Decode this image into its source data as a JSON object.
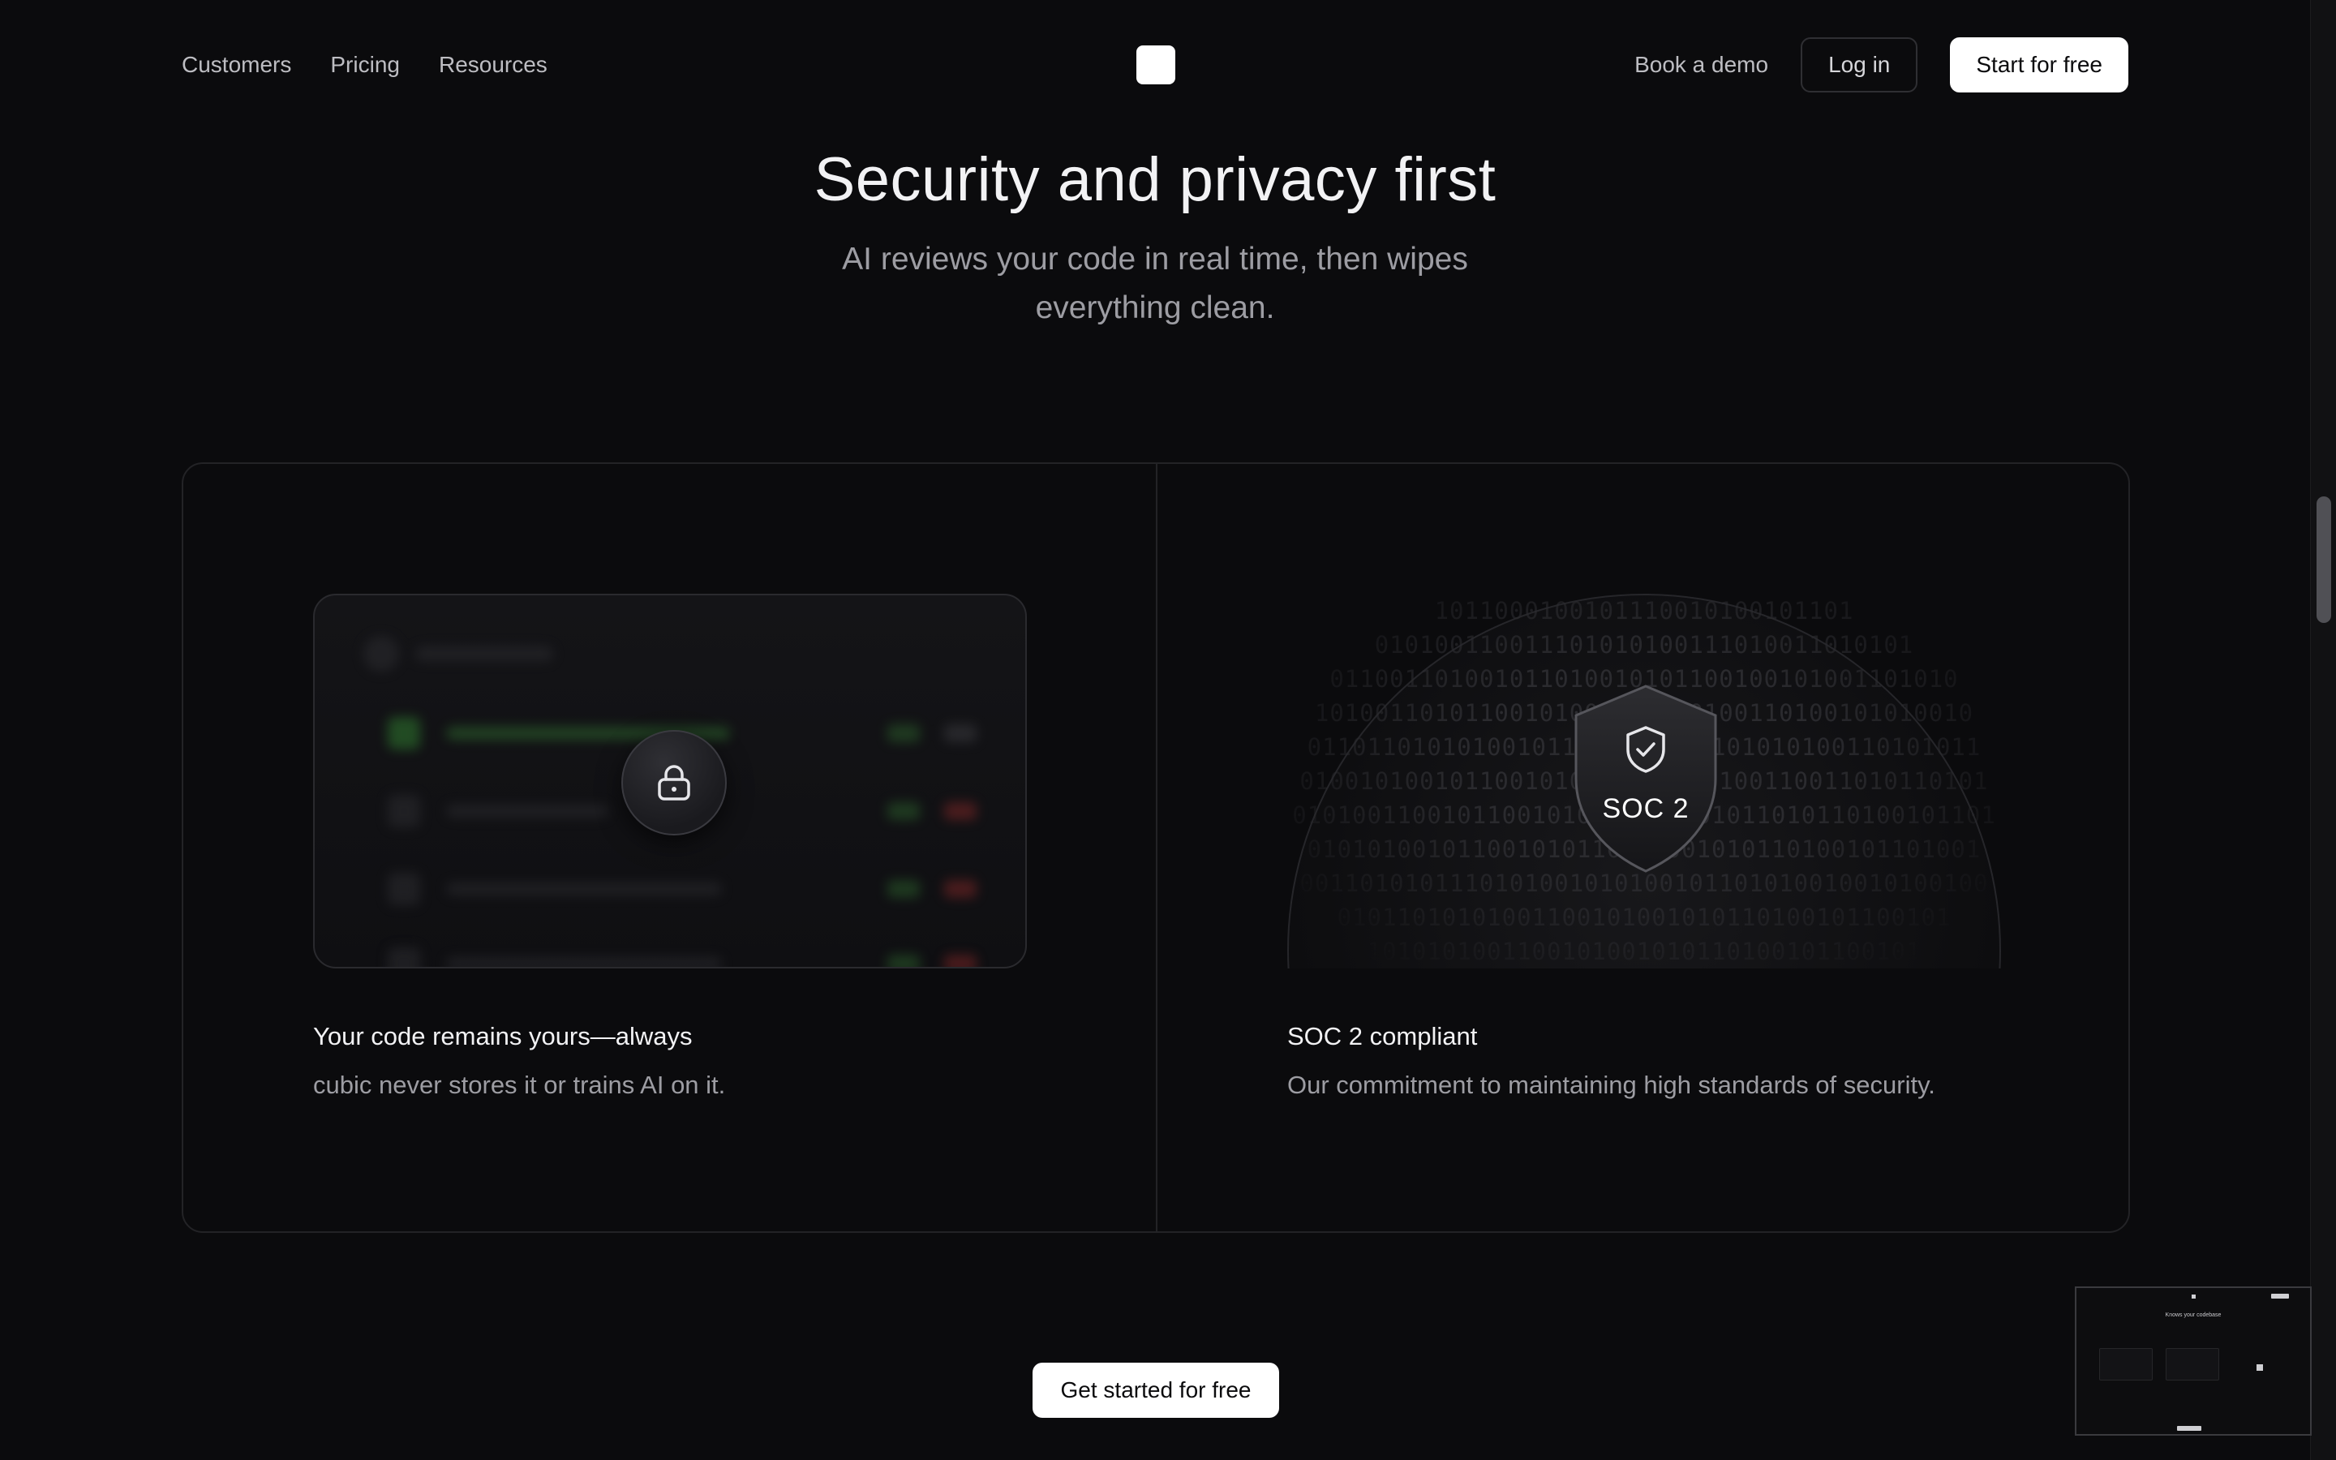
{
  "nav": {
    "links": [
      "Customers",
      "Pricing",
      "Resources"
    ],
    "book_demo": "Book a demo",
    "login": "Log in",
    "start_free": "Start for free"
  },
  "hero": {
    "title": "Security and privacy first",
    "subtitle": "AI reviews your code in real time, then wipes everything clean."
  },
  "features": [
    {
      "title": "Your code remains yours—always",
      "description": "cubic never stores it or trains AI on it.",
      "icon": "lock-icon"
    },
    {
      "title": "SOC 2 compliant",
      "description": "Our commitment to maintaining high standards of security.",
      "icon": "shield-check-icon",
      "badge": "SOC 2"
    }
  ],
  "cta": {
    "label": "Get started for free"
  },
  "minimap": {
    "heading": "Knows your codebase"
  },
  "colors": {
    "background": "#0b0b0d",
    "border": "#232326",
    "muted_text": "#9d9da3",
    "accent_green": "#2f7a2f",
    "accent_red": "#7a2626"
  }
}
